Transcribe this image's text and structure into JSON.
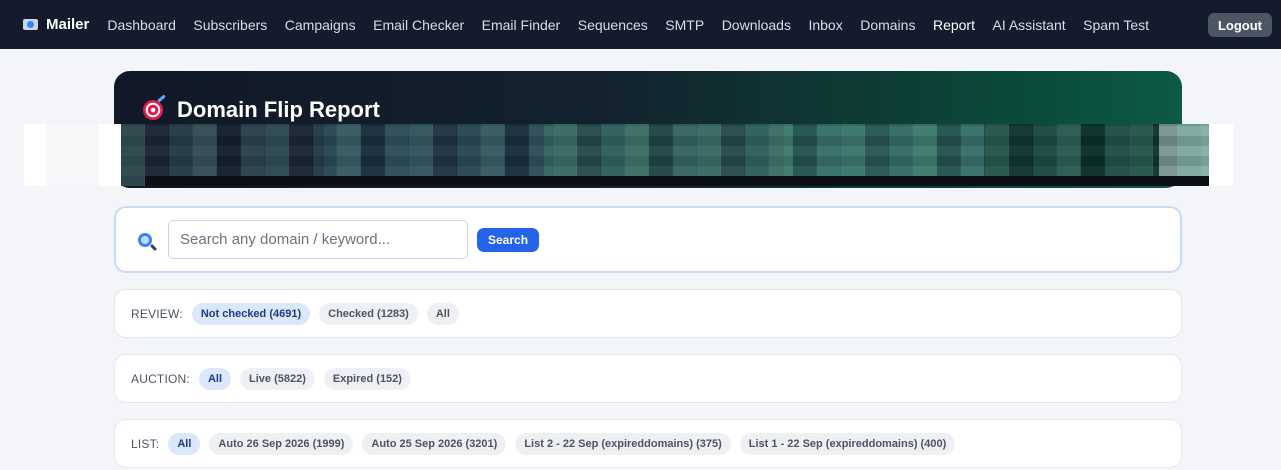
{
  "nav": {
    "brand": "Mailer",
    "brand_icon": "mailer-logo-icon",
    "links": [
      "Dashboard",
      "Subscribers",
      "Campaigns",
      "Email Checker",
      "Email Finder",
      "Sequences",
      "SMTP",
      "Downloads",
      "Inbox",
      "Domains",
      "Report",
      "AI Assistant",
      "Spam Test"
    ],
    "active": "Report",
    "logout_label": "Logout"
  },
  "hero": {
    "title": "Domain Flip Report",
    "icon": "target-icon"
  },
  "search": {
    "placeholder": "Search any domain / keyword...",
    "value": "",
    "button_label": "Search",
    "icon": "search-icon"
  },
  "filters": {
    "review": {
      "label": "REVIEW:",
      "chips": [
        "Not checked (4691)",
        "Checked (1283)",
        "All"
      ],
      "active_index": 0
    },
    "auction": {
      "label": "AUCTION:",
      "chips": [
        "All",
        "Live (5822)",
        "Expired (152)"
      ],
      "active_index": 0
    },
    "list": {
      "label": "LIST:",
      "chips": [
        "All",
        "Auto 26 Sep 2026 (1999)",
        "Auto 25 Sep 2026 (3201)",
        "List 2 - 22 Sep (expireddomains) (375)",
        "List 1 - 22 Sep (expireddomains) (400)"
      ],
      "active_index": 0
    }
  },
  "colors": {
    "nav_bg": "#141b2d",
    "accent": "#2563eb",
    "chip_active_bg": "#dbe7fb",
    "hero_gradient_end": "#0c5a44"
  }
}
